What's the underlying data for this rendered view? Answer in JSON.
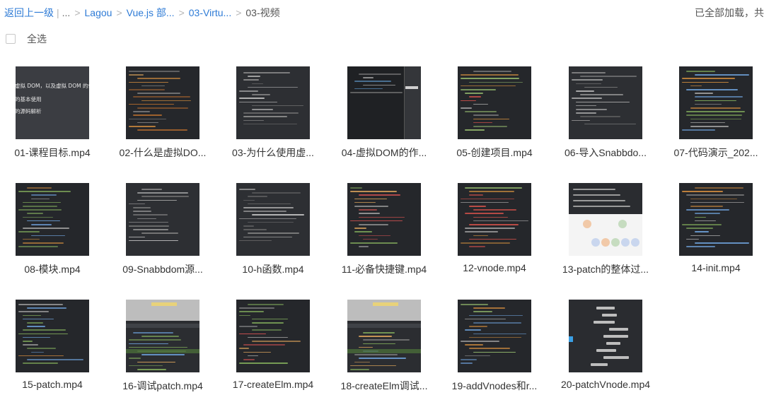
{
  "breadcrumb": {
    "back_label": "返回上一级",
    "ellipsis": "...",
    "items": [
      "Lagou",
      "Vue.js 部...",
      "03-Virtu..."
    ],
    "current": "03-视频"
  },
  "status": "已全部加载，共",
  "select_all_label": "全选",
  "files": [
    {
      "name": "01-课程目标.mp4",
      "theme": "slide"
    },
    {
      "name": "02-什么是虚拟DO...",
      "theme": "code-orange"
    },
    {
      "name": "03-为什么使用虚...",
      "theme": "doc-dark"
    },
    {
      "name": "04-虚拟DOM的作...",
      "theme": "editor"
    },
    {
      "name": "05-创建项目.mp4",
      "theme": "code-red"
    },
    {
      "name": "06-导入Snabbdo...",
      "theme": "doc-dark"
    },
    {
      "name": "07-代码演示_202...",
      "theme": "code-green"
    },
    {
      "name": "08-模块.mp4",
      "theme": "code-green"
    },
    {
      "name": "09-Snabbdom源...",
      "theme": "doc-dark"
    },
    {
      "name": "10-h函数.mp4",
      "theme": "doc-dark"
    },
    {
      "name": "11-必备快捷键.mp4",
      "theme": "code-mixed"
    },
    {
      "name": "12-vnode.mp4",
      "theme": "code-red"
    },
    {
      "name": "13-patch的整体过...",
      "theme": "diagram"
    },
    {
      "name": "14-init.mp4",
      "theme": "code-green"
    },
    {
      "name": "15-patch.mp4",
      "theme": "code-green"
    },
    {
      "name": "16-调试patch.mp4",
      "theme": "browser"
    },
    {
      "name": "17-createElm.mp4",
      "theme": "code-mixed"
    },
    {
      "name": "18-createElm调试...",
      "theme": "browser"
    },
    {
      "name": "19-addVnodes和r...",
      "theme": "code-blue"
    },
    {
      "name": "20-patchVnode.mp4",
      "theme": "mindmap"
    }
  ],
  "slide_text": [
    "虚拟 DOM，以及虚拟 DOM 的作用",
    "的基本使用",
    "的源码解析"
  ]
}
